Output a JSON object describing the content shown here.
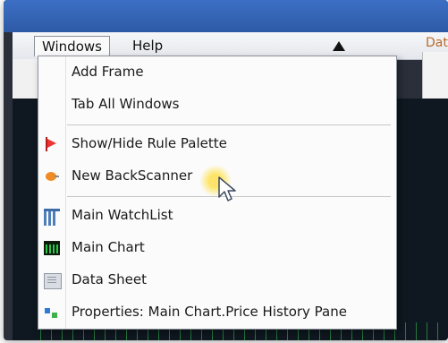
{
  "menubar": {
    "windows_label": "Windows",
    "help_label": "Help",
    "right_partial": "Dat"
  },
  "dropdown": {
    "items": [
      {
        "label": "Add Frame",
        "icon": null
      },
      {
        "label": "Tab All Windows",
        "icon": null
      },
      {
        "label": "Show/Hide Rule Palette",
        "icon": "red-flag-icon"
      },
      {
        "label": "New BackScanner",
        "icon": "orange-scanner-icon"
      },
      {
        "label": "Main WatchList",
        "icon": "watchlist-icon"
      },
      {
        "label": "Main Chart",
        "icon": "chart-icon"
      },
      {
        "label": "Data Sheet",
        "icon": "datasheet-icon"
      },
      {
        "label": "Properties: Main Chart.Price History Pane",
        "icon": "properties-icon"
      }
    ]
  },
  "colors": {
    "titlebar": "#2e5aa6",
    "menu_bg": "#fbfbfb",
    "accent_orange": "#f08a24",
    "accent_red": "#e33333",
    "chart_green": "#29c74a"
  }
}
